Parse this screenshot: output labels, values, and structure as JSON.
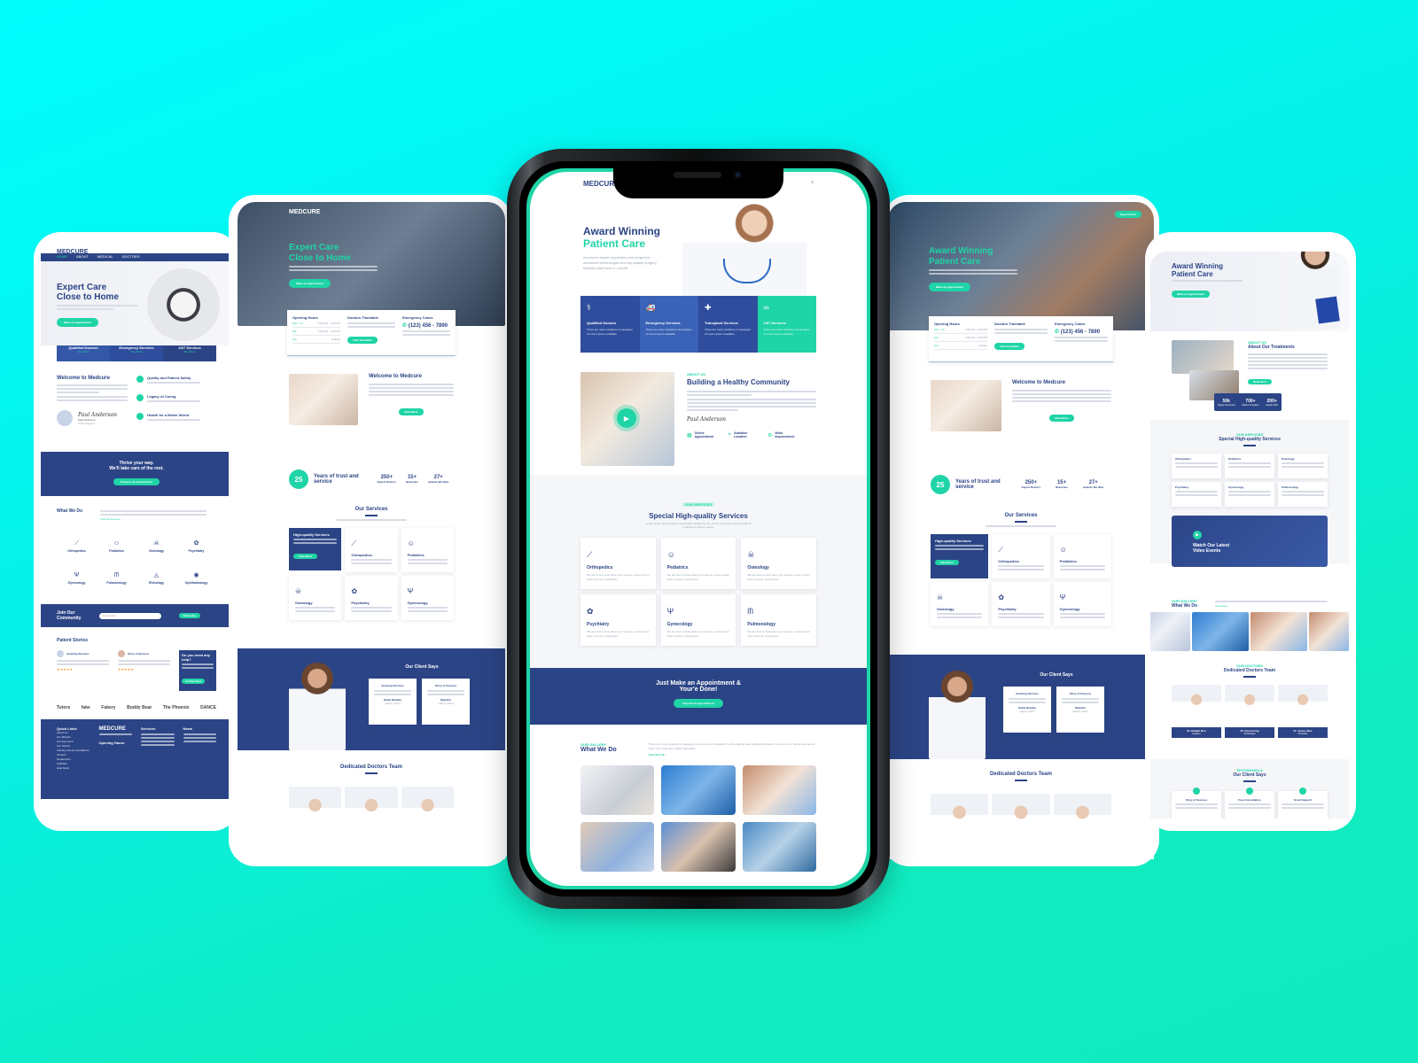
{
  "brand": {
    "name": "MEDCURE",
    "accent": "#1fd4a6",
    "primary": "#2b4485",
    "background_top": "#00fdfd",
    "background_bottom": "#10eac0"
  },
  "phone_center": {
    "logo": "MEDCURE",
    "hero": {
      "title_line1": "Award Winning",
      "title_line2": "Patient Care",
      "text": "Access to expert physicians and surgeons, advanced technologies and top-quality surgery facilities right here in Lincoln."
    },
    "features": [
      {
        "icon": "doctor-icon",
        "title": "Qualified Doctors",
        "text": "There are many variations of passages of Lorem Ipsum available."
      },
      {
        "icon": "ambulance-icon",
        "title": "Emergency Services",
        "text": "There are many variations of passages of Lorem Ipsum available."
      },
      {
        "icon": "medical-kit-icon",
        "title": "Transplant Services",
        "text": "There are many variations of passages of Lorem Ipsum available."
      },
      {
        "icon": "stethoscope-icon",
        "title": "24/7 Services",
        "text": "There are many variations of passages of Lorem Ipsum available."
      }
    ],
    "about": {
      "tag": "ABOUT US",
      "title": "Building a Healthy Community",
      "signature": "Paul Anderson",
      "highlights": [
        {
          "icon": "calendar-icon",
          "label": "Online Appointment"
        },
        {
          "icon": "location-pin-icon",
          "label": "Available Location"
        },
        {
          "icon": "gear-icon",
          "label": "Work Improvement"
        }
      ]
    },
    "services": {
      "tag": "OUR SERVICES",
      "title": "Special High-quality Services",
      "subtitle": "Lorem ipsum dolor sit amet, consectetur adipiscing elit, sed do eiusmod tempor incididunt ut labore et dolore magna.",
      "items": [
        {
          "icon": "bone-icon",
          "name": "Orthopedics",
          "text": "We are here to help when you need us. Lorem ipsum dolor sit amet, consectetur"
        },
        {
          "icon": "child-icon",
          "name": "Pediatrics",
          "text": "We are here to help when you need us. Lorem ipsum dolor sit amet, consectetur"
        },
        {
          "icon": "skull-icon",
          "name": "Osteology",
          "text": "We are here to help when you need us. Lorem ipsum dolor sit amet, consectetur"
        },
        {
          "icon": "brain-icon",
          "name": "Psychiatry",
          "text": "We are here to help when you need us. Lorem ipsum dolor sit amet, consectetur"
        },
        {
          "icon": "uterus-icon",
          "name": "Gynecology",
          "text": "We are here to help when you need us. Lorem ipsum dolor sit amet, consectetur"
        },
        {
          "icon": "lungs-icon",
          "name": "Pulmonology",
          "text": "We are here to help when you need us. Lorem ipsum dolor sit amet, consectetur"
        }
      ]
    },
    "cta": {
      "title_line1": "Just Make an Appointment &",
      "title_line2": "Your'e Done!",
      "button": "Request an Appointment"
    },
    "gallery": {
      "tag": "OUR GALLERY",
      "title": "What We Do",
      "text": "There are many variations of passages of Lorem Ipsum available, but the majority have suffered alteration in some form or randomised words which don't look even slightly believable.",
      "link": "View More"
    }
  },
  "page_left": {
    "logo": "MEDCURE",
    "nav": [
      "HOME",
      "ABOUT",
      "MEDICAL",
      "DOCTORS"
    ],
    "hero": {
      "title_line1": "Expert Care",
      "title_line2": "Close to Home",
      "button": "Make an Appointment"
    },
    "features": [
      {
        "title": "Qualified Doctors",
        "link": "See More"
      },
      {
        "title": "Emergency Services",
        "link": "See More"
      },
      {
        "title": "24/7 Services",
        "link": "See More"
      }
    ],
    "welcome": {
      "title": "Welcome to Medcure",
      "signature": "Paul Anderson",
      "name": "Paul Anderson",
      "role": "Chief Surgeon"
    },
    "values": [
      {
        "icon": "shield-icon",
        "title": "Quality and Patient Safety"
      },
      {
        "icon": "heart-icon",
        "title": "Legacy of Caring"
      },
      {
        "icon": "globe-icon",
        "title": "Health for a Better World"
      }
    ],
    "banner": {
      "line1": "Thrive your way.",
      "line2": "We'll take care of the rest.",
      "button": "Request an Appointment"
    },
    "what_we_do": {
      "title": "What We Do",
      "link": "View All Services",
      "items": [
        "Orthopedics",
        "Pediatrics",
        "Osteology",
        "Psychiatry",
        "Gynecology",
        "Pulmonology",
        "Rhinology",
        "Ophthalmology"
      ]
    },
    "community": {
      "title_line1": "Join Our",
      "title_line2": "Community",
      "placeholder": "Your Email",
      "button": "Subscribe"
    },
    "stories": {
      "title": "Patient Stories",
      "items": [
        {
          "title": "Amazing Services"
        },
        {
          "title": "Story of Success"
        }
      ],
      "help": {
        "title": "Do you need any help?",
        "button": "Contact Now"
      }
    },
    "logos": [
      "Tutors",
      "fake",
      "Fakery",
      "Buddy Bear",
      "The Phoenix",
      "DANCE"
    ],
    "footer": {
      "quick_links": "Quick Links",
      "opening_hours": "Opening Hours",
      "services": "Services",
      "news": "News",
      "links": [
        "About Us",
        "Our Mission",
        "Our Approach",
        "Our History",
        "Industry Recommendations",
        "Careers",
        "Department",
        "Facilities",
        "Help Desk"
      ]
    }
  },
  "page_second": {
    "logo": "MEDCURE",
    "hero": {
      "title_line1": "Expert Care",
      "title_line2": "Close to Home",
      "button": "Make an Appointment"
    },
    "info": {
      "opening_title": "Opening Hours",
      "hours": [
        {
          "day": "Mon - Fri",
          "time": "9:00 AM - 5:00 PM"
        },
        {
          "day": "Sat",
          "time": "9:00 AM - 5:00 PM"
        },
        {
          "day": "Sun",
          "time": "Holiday"
        }
      ],
      "timetable_title": "Doctors Timetable",
      "timetable_button": "View Timetable",
      "emergency_title": "Emergency Cases",
      "phone": "(123) 456 - 7890"
    },
    "welcome": {
      "title": "Welcome to Medcure",
      "button": "Read More"
    },
    "stats": {
      "years": "25",
      "years_label": "Years of trust and service",
      "items": [
        {
          "value": "250+",
          "label": "Expert Doctors"
        },
        {
          "value": "15+",
          "label": "Branches"
        },
        {
          "value": "27+",
          "label": "Awards We Won"
        }
      ]
    },
    "services": {
      "title": "Our Services",
      "featured": {
        "title": "High-quality Services",
        "button": "View More"
      },
      "items": [
        "Orthopedics",
        "Pediatrics",
        "Osteology",
        "Psychiatry",
        "Gynecology"
      ]
    },
    "testimonials": {
      "title": "Our Client Says",
      "items": [
        {
          "title": "Amazing Services",
          "name": "Hattie Bradley",
          "role": "Happy Client"
        },
        {
          "title": "Story of Success",
          "name": "Natasha",
          "role": "Happy Client"
        }
      ]
    },
    "team": {
      "title": "Dedicated Doctors Team"
    }
  },
  "page_fourth": {
    "button_top": "Appointment",
    "hero": {
      "title_line1": "Award Winning",
      "title_line2": "Patient Care",
      "button": "Make an Appointment"
    },
    "info": {
      "opening_title": "Opening Hours",
      "hours": [
        {
          "day": "Mon - Fri",
          "time": "9:00 AM - 5:00 PM"
        },
        {
          "day": "Sat",
          "time": "9:00 AM - 5:00 PM"
        },
        {
          "day": "Sun",
          "time": "Holiday"
        }
      ],
      "timetable_title": "Doctors Timetable",
      "timetable_button": "View Timetable",
      "emergency_title": "Emergency Cases",
      "phone": "(123) 456 - 7890"
    },
    "welcome": {
      "title": "Welcome to Medcure",
      "button": "Read More"
    },
    "stats": {
      "years": "25",
      "years_label": "Years of trust and service",
      "items": [
        {
          "value": "250+",
          "label": "Expert Doctors"
        },
        {
          "value": "15+",
          "label": "Branches"
        },
        {
          "value": "27+",
          "label": "Awards We Won"
        }
      ]
    },
    "services": {
      "title": "Our Services",
      "featured": {
        "title": "High-quality Services",
        "button": "View More"
      },
      "items": [
        "Orthopedics",
        "Pediatrics",
        "Osteology",
        "Psychiatry",
        "Gynecology"
      ]
    },
    "testimonials": {
      "title": "Our Client Says",
      "items": [
        {
          "title": "Amazing Services",
          "name": "Hattie Bradley",
          "role": "Happy Client"
        },
        {
          "title": "Story of Success",
          "name": "Natasha",
          "role": "Happy Client"
        }
      ]
    },
    "team": {
      "title": "Dedicated Doctors Team"
    }
  },
  "page_right": {
    "hero": {
      "title_line1": "Award Winning",
      "title_line2": "Patient Care",
      "button": "Make an Appointment"
    },
    "about": {
      "tag": "ABOUT US",
      "title": "About Our Treatments",
      "button": "Read More",
      "stats": [
        {
          "value": "50k",
          "label": "Happy Customers"
        },
        {
          "value": "700+",
          "label": "Patient Complete"
        },
        {
          "value": "200+",
          "label": "Awards Won"
        }
      ]
    },
    "services": {
      "tag": "OUR SERVICES",
      "title": "Special High-quality Services",
      "items": [
        "Orthopedics",
        "Pediatrics",
        "Osteology",
        "Psychiatry",
        "Gynecology",
        "Pulmonology"
      ]
    },
    "video": {
      "title_line1": "Watch Our Latest",
      "title_line2": "Video Events"
    },
    "what_we_do": {
      "tag": "OUR GALLERY",
      "title": "What We Do",
      "link": "View More"
    },
    "team": {
      "tag": "OUR DOCTORS",
      "title": "Dedicated Doctors Team",
      "members": [
        {
          "name": "Dr. Dwight Ben",
          "role": "Surgeon"
        },
        {
          "name": "Dr. Kevin Krug",
          "role": "Cardiologist"
        },
        {
          "name": "Dr. Jenny Glen",
          "role": "Physician"
        }
      ]
    },
    "testimonials": {
      "tag": "TESTIMONIALS",
      "title": "Our Client Says",
      "items": [
        "Story of Success",
        "Free Consultation",
        "Great Support"
      ]
    }
  }
}
